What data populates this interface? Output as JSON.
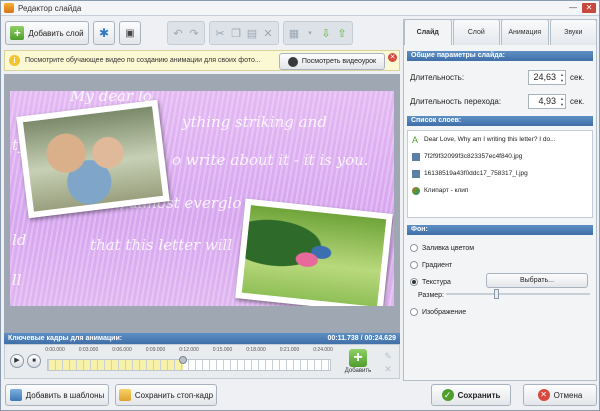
{
  "window": {
    "title": "Редактор слайда"
  },
  "toolbar": {
    "add_layer": "Добавить слой"
  },
  "hint": {
    "text": "Посмотрите обучающее видео по созданию анимации для своих фото...",
    "watch_label": "Посмотреть видеоурок"
  },
  "letter_lines": [
    "My dear lo",
    "ything striking and",
    "o write about it - it is you.",
    "I know, almost everglo",
    "that this letter will",
    "ty",
    "ld",
    "ll"
  ],
  "keyframes": {
    "label": "Ключевые кадры для анимации:",
    "time": "00:11.738 / 00:24.629",
    "ticks": [
      "0:00.000",
      "0:03.000",
      "0:06.000",
      "0:09.000",
      "0:12.000",
      "0:15.000",
      "0:18.000",
      "0:21.000",
      "0:24.000"
    ],
    "add_label": "Добавить",
    "position": 0.48
  },
  "bottom": {
    "templates": "Добавить в шаблоны",
    "save_frame": "Сохранить стоп-кадр",
    "save": "Сохранить",
    "cancel": "Отмена"
  },
  "tabs": [
    "Слайд",
    "Слой",
    "Анимация",
    "Звуки"
  ],
  "slide_params": {
    "header": "Общие параметры слайда:",
    "duration_label": "Длительность:",
    "duration": "24,63",
    "transition_label": "Длительность перехода:",
    "transition": "4,93",
    "unit": "сек."
  },
  "layers": {
    "header": "Список слоев:",
    "items": [
      "Dear Love, Why am I writing this letter? I do...",
      "7f2f9f32099f3c823357ec4f840.jpg",
      "16138519a43f0ddc17_758317_l.jpg",
      "Клипарт - клип"
    ]
  },
  "background": {
    "header": "Фон:",
    "options": [
      "Заливка цветом",
      "Градиент",
      "Текстура",
      "Изображение"
    ],
    "selected": "Текстура",
    "choose": "Выбрать...",
    "size_label": "Размер:",
    "size_value": 0.33
  },
  "colors": {
    "accent": "#3f6fa6",
    "primary_green": "#64b03c",
    "danger": "#d9483e",
    "hint_bg": "#fbf9d3"
  }
}
